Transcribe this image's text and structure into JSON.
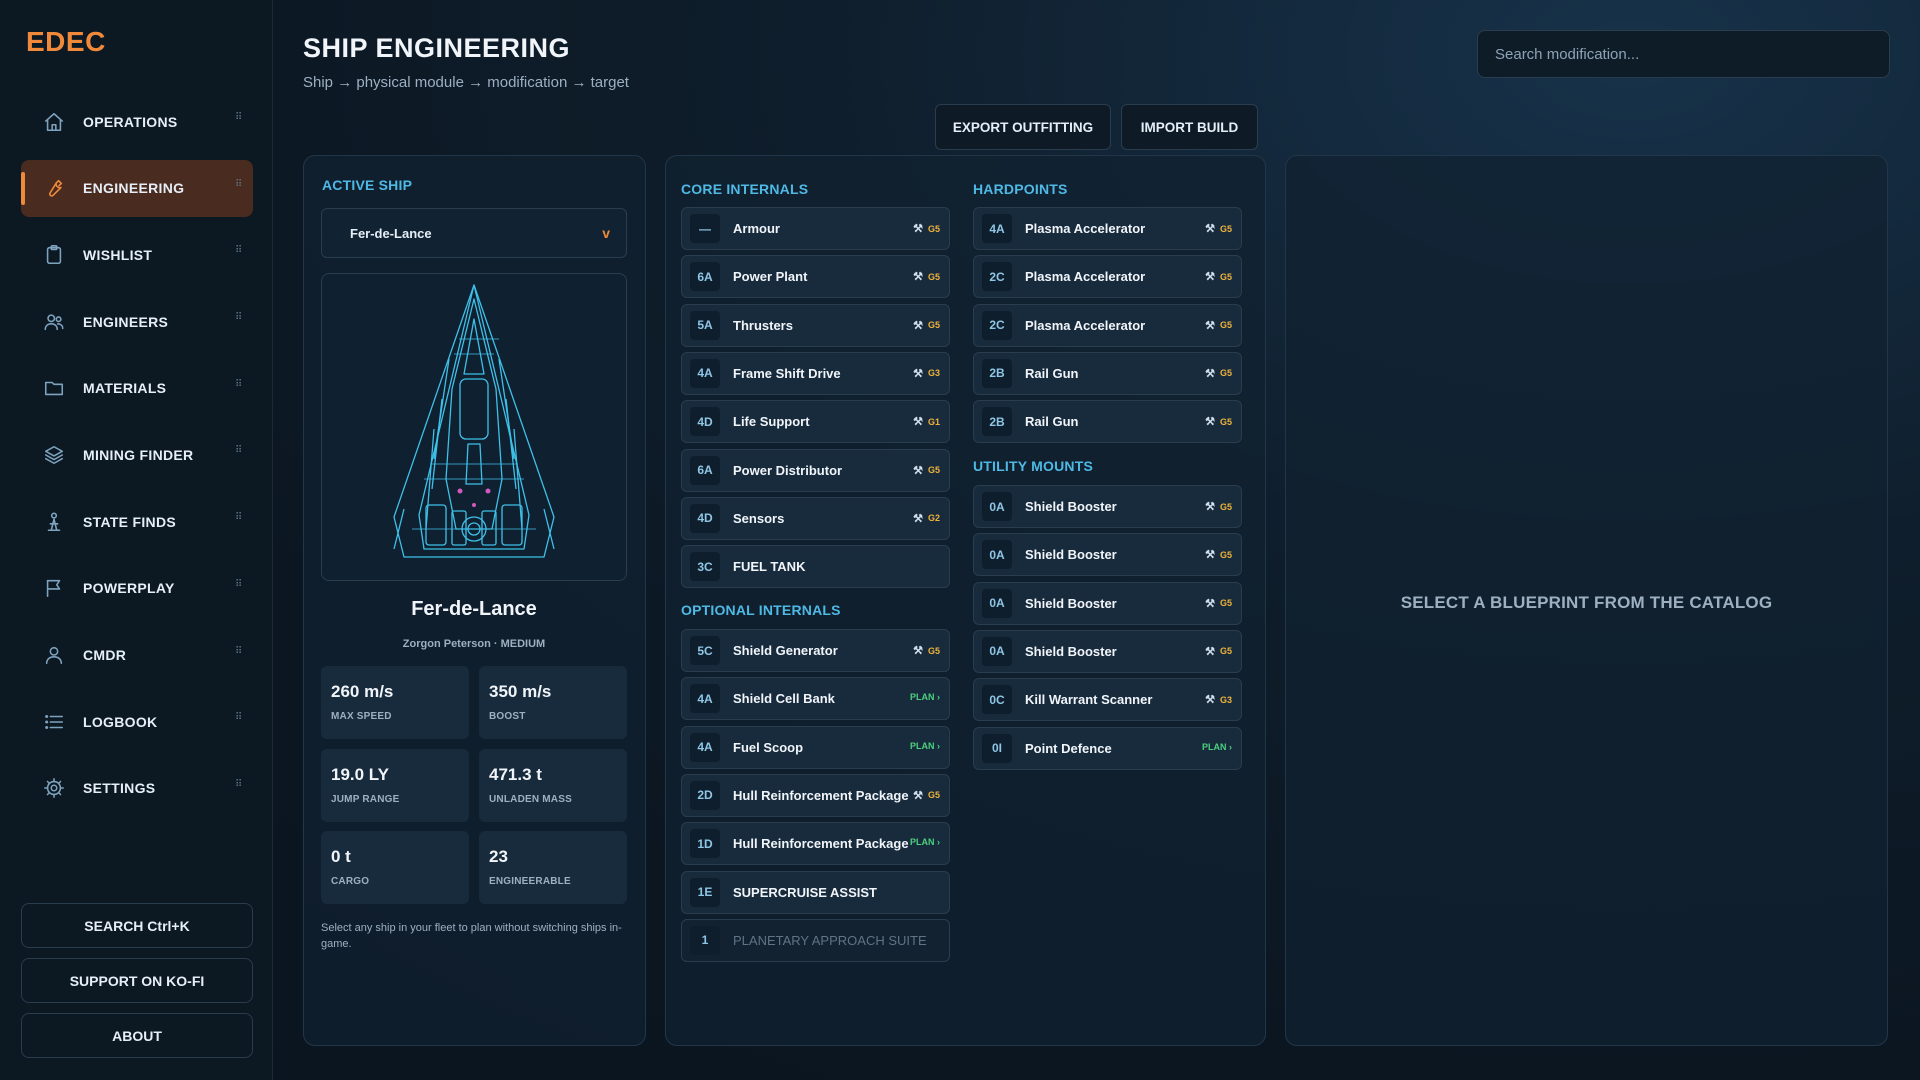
{
  "app": {
    "logo": "EDEC"
  },
  "sidebar": {
    "items": [
      {
        "label": "OPERATIONS",
        "icon": "home-icon",
        "active": false
      },
      {
        "label": "ENGINEERING",
        "icon": "wrench-icon",
        "active": true
      },
      {
        "label": "WISHLIST",
        "icon": "clipboard-icon",
        "active": false
      },
      {
        "label": "ENGINEERS",
        "icon": "users-icon",
        "active": false
      },
      {
        "label": "MATERIALS",
        "icon": "folder-icon",
        "active": false
      },
      {
        "label": "MINING FINDER",
        "icon": "layers-icon",
        "active": false
      },
      {
        "label": "STATE FINDS",
        "icon": "person-flask-icon",
        "active": false
      },
      {
        "label": "POWERPLAY",
        "icon": "flag-icon",
        "active": false
      },
      {
        "label": "CMDR",
        "icon": "user-icon",
        "active": false
      },
      {
        "label": "LOGBOOK",
        "icon": "list-icon",
        "active": false
      },
      {
        "label": "SETTINGS",
        "icon": "gear-icon",
        "active": false
      }
    ],
    "buttons": {
      "search": "SEARCH  Ctrl+K",
      "support": "SUPPORT ON KO-FI",
      "about": "ABOUT"
    }
  },
  "header": {
    "title": "SHIP ENGINEERING",
    "subtitle": "Ship → physical module → modification → target",
    "search_placeholder": "Search modification...",
    "export_label": "EXPORT OUTFITTING",
    "import_label": "IMPORT BUILD"
  },
  "ship": {
    "section_title": "ACTIVE SHIP",
    "selected": "Fer-de-Lance",
    "name": "Fer-de-Lance",
    "meta": "Zorgon Peterson · MEDIUM",
    "stats": [
      {
        "value": "260 m/s",
        "label": "MAX SPEED"
      },
      {
        "value": "350 m/s",
        "label": "BOOST"
      },
      {
        "value": "19.0 LY",
        "label": "JUMP RANGE"
      },
      {
        "value": "471.3 t",
        "label": "UNLADEN MASS"
      },
      {
        "value": "0 t",
        "label": "CARGO"
      },
      {
        "value": "23",
        "label": "ENGINEERABLE"
      }
    ],
    "hint": "Select any ship in your fleet to plan without switching ships in-game."
  },
  "modules": {
    "core_title": "CORE INTERNALS",
    "core": [
      {
        "cls": "—",
        "name": "Armour",
        "tag": "G5",
        "type": "grade"
      },
      {
        "cls": "6A",
        "name": "Power Plant",
        "tag": "G5",
        "type": "grade"
      },
      {
        "cls": "5A",
        "name": "Thrusters",
        "tag": "G5",
        "type": "grade"
      },
      {
        "cls": "4A",
        "name": "Frame Shift Drive",
        "tag": "G3",
        "type": "grade"
      },
      {
        "cls": "4D",
        "name": "Life Support",
        "tag": "G1",
        "type": "grade"
      },
      {
        "cls": "6A",
        "name": "Power Distributor",
        "tag": "G5",
        "type": "grade"
      },
      {
        "cls": "4D",
        "name": "Sensors",
        "tag": "G2",
        "type": "grade"
      },
      {
        "cls": "3C",
        "name": "FUEL TANK",
        "tag": "",
        "type": "none"
      }
    ],
    "optional_title": "OPTIONAL INTERNALS",
    "optional": [
      {
        "cls": "5C",
        "name": "Shield Generator",
        "tag": "G5",
        "type": "grade"
      },
      {
        "cls": "4A",
        "name": "Shield Cell Bank",
        "tag": "PLAN ›",
        "type": "plan"
      },
      {
        "cls": "4A",
        "name": "Fuel Scoop",
        "tag": "PLAN ›",
        "type": "plan"
      },
      {
        "cls": "2D",
        "name": "Hull Reinforcement Package",
        "tag": "G5",
        "type": "grade"
      },
      {
        "cls": "1D",
        "name": "Hull Reinforcement Package",
        "tag": "PLAN ›",
        "type": "plan"
      },
      {
        "cls": "1E",
        "name": "SUPERCRUISE ASSIST",
        "tag": "",
        "type": "none"
      },
      {
        "cls": "1",
        "name": "PLANETARY APPROACH SUITE",
        "tag": "",
        "type": "dim"
      }
    ],
    "hardpoints_title": "HARDPOINTS",
    "hardpoints": [
      {
        "cls": "4A",
        "name": "Plasma Accelerator",
        "tag": "G5",
        "type": "grade"
      },
      {
        "cls": "2C",
        "name": "Plasma Accelerator",
        "tag": "G5",
        "type": "grade"
      },
      {
        "cls": "2C",
        "name": "Plasma Accelerator",
        "tag": "G5",
        "type": "grade"
      },
      {
        "cls": "2B",
        "name": "Rail Gun",
        "tag": "G5",
        "type": "grade"
      },
      {
        "cls": "2B",
        "name": "Rail Gun",
        "tag": "G5",
        "type": "grade"
      }
    ],
    "utility_title": "UTILITY MOUNTS",
    "utility": [
      {
        "cls": "0A",
        "name": "Shield Booster",
        "tag": "G5",
        "type": "grade"
      },
      {
        "cls": "0A",
        "name": "Shield Booster",
        "tag": "G5",
        "type": "grade"
      },
      {
        "cls": "0A",
        "name": "Shield Booster",
        "tag": "G5",
        "type": "grade"
      },
      {
        "cls": "0A",
        "name": "Shield Booster",
        "tag": "G5",
        "type": "grade"
      },
      {
        "cls": "0C",
        "name": "Kill Warrant Scanner",
        "tag": "G3",
        "type": "grade"
      },
      {
        "cls": "0I",
        "name": "Point Defence",
        "tag": "PLAN ›",
        "type": "plan"
      }
    ]
  },
  "blueprint": {
    "empty_message": "SELECT A BLUEPRINT FROM THE CATALOG"
  },
  "colors": {
    "accent": "#f08a3a",
    "section": "#4fb9e6",
    "grade": "#f0b33a",
    "plan": "#4cd07d"
  }
}
